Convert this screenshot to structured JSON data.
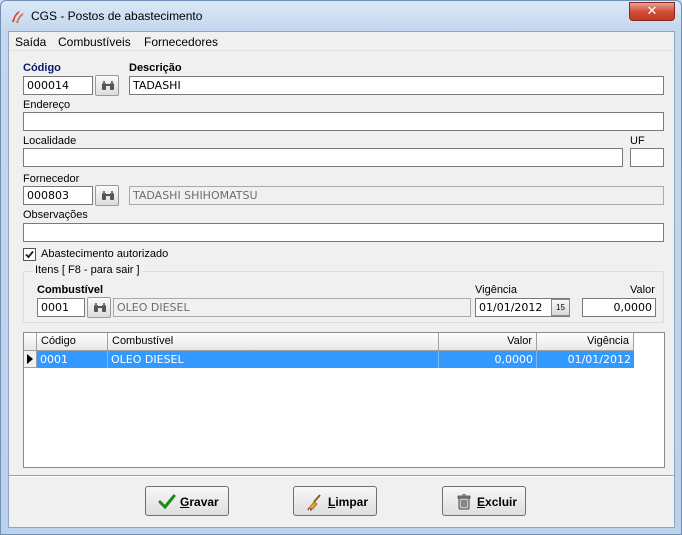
{
  "window": {
    "title": "CGS - Postos de abastecimento",
    "close_glyph": "✕"
  },
  "menu": [
    {
      "label": "Saída"
    },
    {
      "label": "Combustíveis"
    },
    {
      "label": "Fornecedores"
    }
  ],
  "form": {
    "codigo_label": "Código",
    "codigo_value": "000014",
    "descricao_label": "Descrição",
    "descricao_value": "TADASHI",
    "endereco_label": "Endereço",
    "endereco_value": "",
    "localidade_label": "Localidade",
    "localidade_value": "",
    "uf_label": "UF",
    "uf_value": "",
    "fornecedor_label": "Fornecedor",
    "fornecedor_code": "000803",
    "fornecedor_name": "TADASHI SHIHOMATSU",
    "observacoes_label": "Observações",
    "observacoes_value": "",
    "autorizado_label": "Abastecimento autorizado",
    "autorizado_checked": true
  },
  "itens": {
    "group_title": "Itens [ F8 - para sair ]",
    "combustivel_label": "Combustível",
    "combustivel_code": "0001",
    "combustivel_name": "OLEO DIESEL",
    "vigencia_label": "Vigência",
    "vigencia_value": "01/01/2012",
    "calendar_glyph": "15",
    "valor_label": "Valor",
    "valor_value": "0,0000"
  },
  "grid": {
    "columns": [
      "Código",
      "Combustível",
      "Valor",
      "Vigência"
    ],
    "rows": [
      {
        "codigo": "0001",
        "combustivel": "OLEO DIESEL",
        "valor": "0,0000",
        "vigencia": "01/01/2012"
      }
    ]
  },
  "buttons": {
    "gravar": "Gravar",
    "limpar": "Limpar",
    "excluir": "Excluir"
  },
  "colors": {
    "selection": "#3399ff",
    "label_navy": "#0a1a6e"
  }
}
